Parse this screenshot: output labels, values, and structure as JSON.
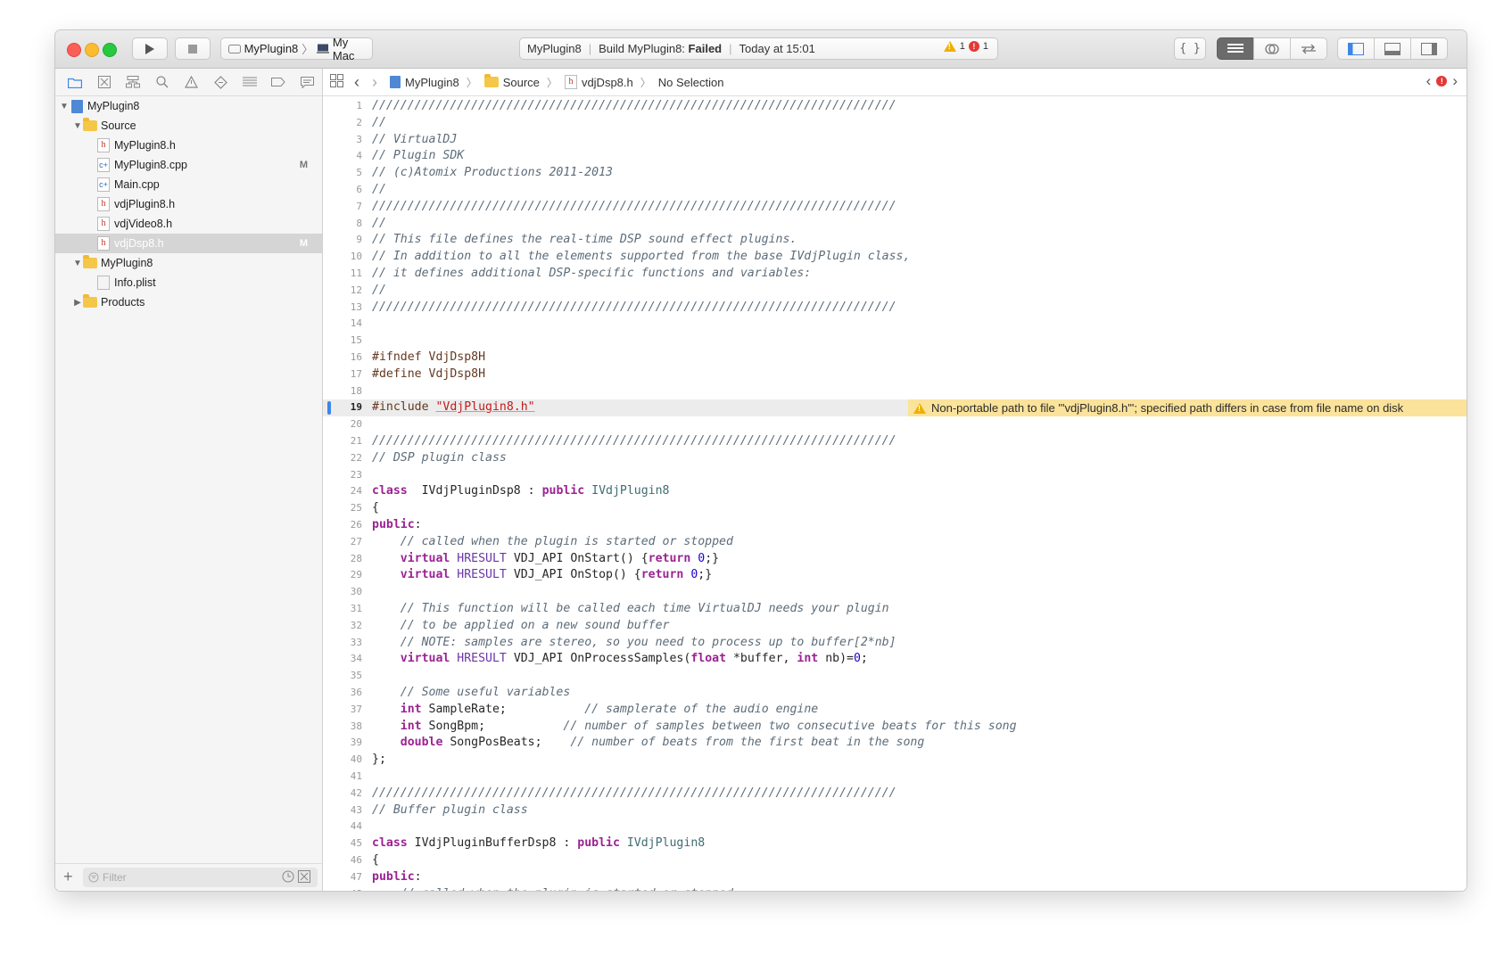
{
  "toolbar": {
    "scheme": "MyPlugin8",
    "destination": "My Mac",
    "status_project": "MyPlugin8",
    "status_build": "Build MyPlugin8:",
    "status_result": "Failed",
    "status_time": "Today at 15:01",
    "warning_count": "1",
    "error_count": "1"
  },
  "navigator": {
    "items": [
      {
        "label": "MyPlugin8",
        "type": "project",
        "depth": 0,
        "expanded": true
      },
      {
        "label": "Source",
        "type": "folder",
        "depth": 1,
        "expanded": true
      },
      {
        "label": "MyPlugin8.h",
        "type": "h",
        "depth": 2
      },
      {
        "label": "MyPlugin8.cpp",
        "type": "cpp",
        "depth": 2,
        "status": "M"
      },
      {
        "label": "Main.cpp",
        "type": "cpp",
        "depth": 2
      },
      {
        "label": "vdjPlugin8.h",
        "type": "h",
        "depth": 2
      },
      {
        "label": "vdjVideo8.h",
        "type": "h",
        "depth": 2
      },
      {
        "label": "vdjDsp8.h",
        "type": "h",
        "depth": 2,
        "status": "M",
        "selected": true
      },
      {
        "label": "MyPlugin8",
        "type": "folder",
        "depth": 1,
        "expanded": true
      },
      {
        "label": "Info.plist",
        "type": "plist",
        "depth": 2
      },
      {
        "label": "Products",
        "type": "folder",
        "depth": 1,
        "expanded": false
      }
    ],
    "filter_placeholder": "Filter"
  },
  "jumpbar": {
    "project": "MyPlugin8",
    "folder": "Source",
    "file": "vdjDsp8.h",
    "selection": "No Selection"
  },
  "editor": {
    "current_line": 19,
    "warning_line": 19,
    "warning_text": "Non-portable path to file '\"vdjPlugin8.h\"'; specified path differs in case from file name on disk",
    "lines": [
      [
        [
          "c",
          "//////////////////////////////////////////////////////////////////////////"
        ]
      ],
      [
        [
          "c",
          "//"
        ]
      ],
      [
        [
          "c",
          "// VirtualDJ"
        ]
      ],
      [
        [
          "c",
          "// Plugin SDK"
        ]
      ],
      [
        [
          "c",
          "// (c)Atomix Productions 2011-2013"
        ]
      ],
      [
        [
          "c",
          "//"
        ]
      ],
      [
        [
          "c",
          "//////////////////////////////////////////////////////////////////////////"
        ]
      ],
      [
        [
          "c",
          "//"
        ]
      ],
      [
        [
          "c",
          "// This file defines the real-time DSP sound effect plugins."
        ]
      ],
      [
        [
          "c",
          "// In addition to all the elements supported from the base IVdjPlugin class,"
        ]
      ],
      [
        [
          "c",
          "// it defines additional DSP-specific functions and variables:"
        ]
      ],
      [
        [
          "c",
          "//"
        ]
      ],
      [
        [
          "c",
          "//////////////////////////////////////////////////////////////////////////"
        ]
      ],
      [],
      [],
      [
        [
          "pp",
          "#ifndef VdjDsp8H"
        ]
      ],
      [
        [
          "pp",
          "#define VdjDsp8H"
        ]
      ],
      [],
      [
        [
          "pp",
          "#include "
        ],
        [
          "str",
          "\"VdjPlugin8.h\""
        ]
      ],
      [],
      [
        [
          "c",
          "//////////////////////////////////////////////////////////////////////////"
        ]
      ],
      [
        [
          "c",
          "// DSP plugin class"
        ]
      ],
      [],
      [
        [
          "k",
          "class"
        ],
        [
          "",
          "  IVdjPluginDsp8 : "
        ],
        [
          "k",
          "public"
        ],
        [
          "",
          " "
        ],
        [
          "cls",
          "IVdjPlugin8"
        ]
      ],
      [
        [
          "",
          "{"
        ]
      ],
      [
        [
          "k",
          "public"
        ],
        [
          "",
          ":"
        ]
      ],
      [
        [
          "",
          "    "
        ],
        [
          "c",
          "// called when the plugin is started or stopped"
        ]
      ],
      [
        [
          "",
          "    "
        ],
        [
          "k",
          "virtual"
        ],
        [
          "",
          " "
        ],
        [
          "t",
          "HRESULT"
        ],
        [
          "",
          ""
        ],
        [
          "",
          " VDJ_API OnStart() {"
        ],
        [
          "k",
          "return"
        ],
        [
          "",
          " "
        ],
        [
          "num",
          "0"
        ],
        [
          "",
          ";}"
        ]
      ],
      [
        [
          "",
          "    "
        ],
        [
          "k",
          "virtual"
        ],
        [
          "",
          " "
        ],
        [
          "t",
          "HRESULT"
        ],
        [
          "",
          " VDJ_API OnStop() {"
        ],
        [
          "k",
          "return"
        ],
        [
          "",
          " "
        ],
        [
          "num",
          "0"
        ],
        [
          "",
          ";}"
        ]
      ],
      [],
      [
        [
          "",
          "    "
        ],
        [
          "c",
          "// This function will be called each time VirtualDJ needs your plugin"
        ]
      ],
      [
        [
          "",
          "    "
        ],
        [
          "c",
          "// to be applied on a new sound buffer"
        ]
      ],
      [
        [
          "",
          "    "
        ],
        [
          "c",
          "// NOTE: samples are stereo, so you need to process up to buffer[2*nb]"
        ]
      ],
      [
        [
          "",
          "    "
        ],
        [
          "k",
          "virtual"
        ],
        [
          "",
          " "
        ],
        [
          "t",
          "HRESULT"
        ],
        [
          "",
          " VDJ_API OnProcessSamples("
        ],
        [
          "k",
          "float"
        ],
        [
          "",
          " *buffer, "
        ],
        [
          "k",
          "int"
        ],
        [
          "",
          " nb)="
        ],
        [
          "num",
          "0"
        ],
        [
          "",
          ";"
        ]
      ],
      [],
      [
        [
          "",
          "    "
        ],
        [
          "c",
          "// Some useful variables"
        ]
      ],
      [
        [
          "",
          "    "
        ],
        [
          "k",
          "int"
        ],
        [
          "",
          " SampleRate;           "
        ],
        [
          "c",
          "// samplerate of the audio engine"
        ]
      ],
      [
        [
          "",
          "    "
        ],
        [
          "k",
          "int"
        ],
        [
          "",
          " SongBpm;           "
        ],
        [
          "c",
          "// number of samples between two consecutive beats for this song"
        ]
      ],
      [
        [
          "",
          "    "
        ],
        [
          "k",
          "double"
        ],
        [
          "",
          " SongPosBeats;    "
        ],
        [
          "c",
          "// number of beats from the first beat in the song"
        ]
      ],
      [
        [
          "",
          "};"
        ]
      ],
      [],
      [
        [
          "c",
          "//////////////////////////////////////////////////////////////////////////"
        ]
      ],
      [
        [
          "c",
          "// Buffer plugin class"
        ]
      ],
      [],
      [
        [
          "k",
          "class"
        ],
        [
          "",
          " IVdjPluginBufferDsp8 : "
        ],
        [
          "k",
          "public"
        ],
        [
          "",
          " "
        ],
        [
          "cls",
          "IVdjPlugin8"
        ]
      ],
      [
        [
          "",
          "{"
        ]
      ],
      [
        [
          "k",
          "public"
        ],
        [
          "",
          ":"
        ]
      ],
      [
        [
          "",
          "    "
        ],
        [
          "c",
          "// called when the plugin is started or stopped"
        ]
      ]
    ]
  }
}
